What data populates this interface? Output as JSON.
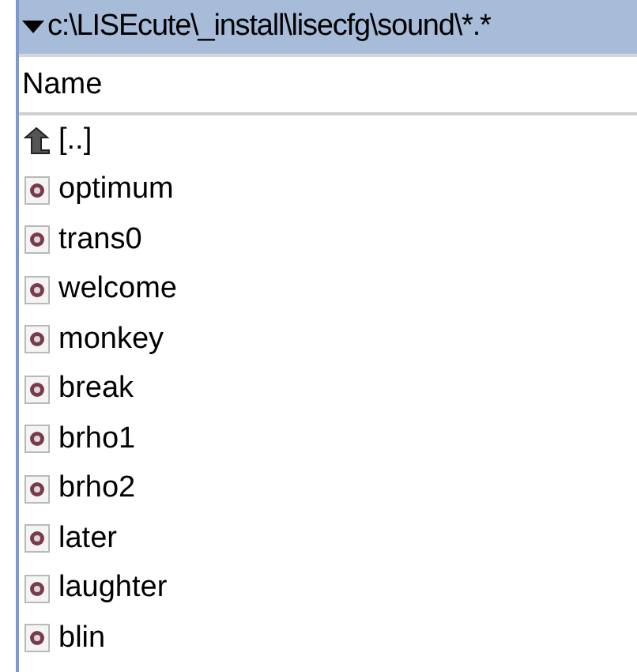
{
  "path_bar": {
    "expanded": true,
    "path": "c:\\LISEcute\\_install\\lisecfg\\sound\\*.*"
  },
  "columns": [
    "Name"
  ],
  "rows": [
    {
      "kind": "parent",
      "name": "[..]"
    },
    {
      "kind": "file",
      "name": "optimum"
    },
    {
      "kind": "file",
      "name": "trans0"
    },
    {
      "kind": "file",
      "name": "welcome"
    },
    {
      "kind": "file",
      "name": "monkey"
    },
    {
      "kind": "file",
      "name": "break"
    },
    {
      "kind": "file",
      "name": "brho1"
    },
    {
      "kind": "file",
      "name": "brho2"
    },
    {
      "kind": "file",
      "name": "later"
    },
    {
      "kind": "file",
      "name": "laughter"
    },
    {
      "kind": "file",
      "name": "blin"
    }
  ]
}
